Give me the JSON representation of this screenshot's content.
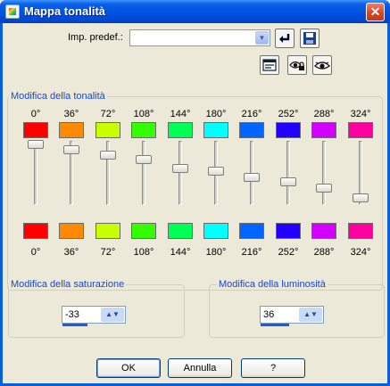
{
  "window": {
    "title": "Mappa tonalità",
    "close_glyph": "✕"
  },
  "preset": {
    "label": "Imp. predef.:",
    "value": "",
    "dropdown_glyph": "▼"
  },
  "hue": {
    "group_title": "Modifica della tonalità",
    "top_degrees": [
      "0°",
      "36°",
      "72°",
      "108°",
      "144°",
      "180°",
      "216°",
      "252°",
      "288°",
      "324°"
    ],
    "bottom_degrees": [
      "0°",
      "36°",
      "72°",
      "108°",
      "144°",
      "180°",
      "216°",
      "252°",
      "288°",
      "324°"
    ],
    "top_colors": [
      "#ff0000",
      "#ff8a00",
      "#c8ff00",
      "#33ff00",
      "#00ff55",
      "#00ffff",
      "#0066ff",
      "#2200ff",
      "#d400ff",
      "#ff00a0"
    ],
    "bottom_colors": [
      "#ff0000",
      "#ff8a00",
      "#c8ff00",
      "#33ff00",
      "#00ff55",
      "#00ffff",
      "#0066ff",
      "#2200ff",
      "#d400ff",
      "#ff00a0"
    ],
    "slider_levels": [
      0.0,
      0.1,
      0.19,
      0.26,
      0.42,
      0.47,
      0.58,
      0.66,
      0.77,
      0.93
    ]
  },
  "saturation": {
    "group_title": "Modifica della saturazione",
    "value": "-33",
    "spin_glyph": "▲▼"
  },
  "luminosity": {
    "group_title": "Modifica della luminosità",
    "value": "36",
    "spin_glyph": "▲▼"
  },
  "buttons": {
    "ok": "OK",
    "cancel": "Annulla",
    "help": "?"
  }
}
